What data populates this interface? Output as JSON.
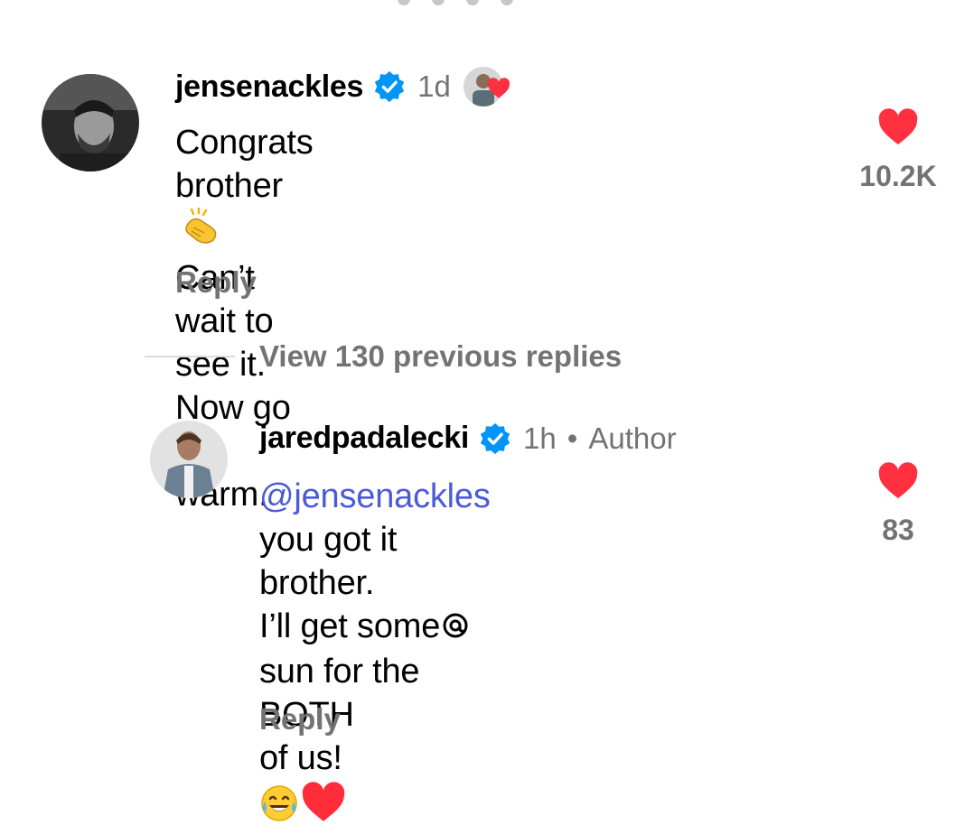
{
  "comments": [
    {
      "username": "jensenackles",
      "time": "1d",
      "lines": [
        "Congrats brother",
        "Can’t wait to see it. Now go get",
        "warm."
      ],
      "reply_label": "Reply",
      "likes": "10.2K",
      "icons": [
        "verified-badge",
        "clapping-hands-emoji",
        "author-liked-heart"
      ]
    },
    {
      "username": "jaredpadalecki",
      "time": "1h",
      "dot": "•",
      "author_label": "Author",
      "mention": "@jensenackles",
      "line1_rest": " you got it",
      "line2": "brother.",
      "line3_a": "I’ll get some",
      "line3_b": "sun for the BOTH",
      "line4": "of us!",
      "reply_label": "Reply",
      "likes": "83",
      "emojis": [
        "tears-of-joy-emoji",
        "red-heart-emoji"
      ]
    }
  ],
  "thread": {
    "view_replies_label": "View 130 previous replies"
  },
  "colors": {
    "like_red": "#ff3040",
    "verified_blue": "#0095f6",
    "mention_blue": "#4a5ad8",
    "secondary_gray": "#737373"
  }
}
